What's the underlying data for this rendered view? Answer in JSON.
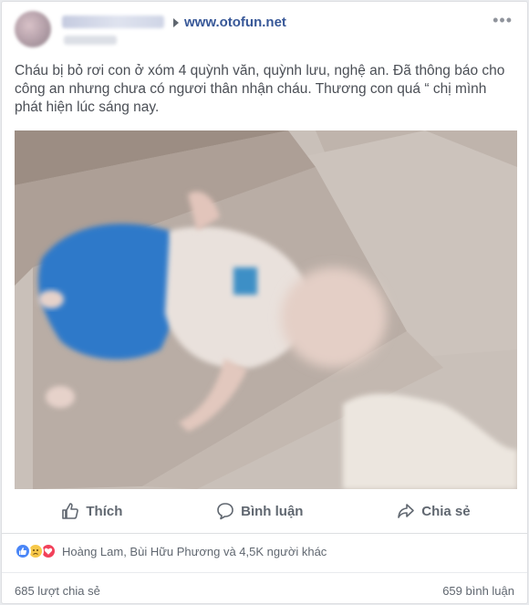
{
  "post": {
    "site": "www.otofun.net",
    "text": "Cháu bị bỏ rơi con ở xóm 4 quỳnh văn, quỳnh lưu, nghệ an. Đã thông báo cho công an nhưng chưa có ngươi thân nhận cháu. Thương con quá “ chị mình phát hiện lúc sáng nay."
  },
  "actions": {
    "like_label": "Thích",
    "comment_label": "Bình luận",
    "share_label": "Chia sẻ"
  },
  "reactions": {
    "types": [
      "like-icon",
      "sad-icon",
      "love-icon"
    ],
    "names": "Hoàng Lam, Bùi Hữu Phương và 4,5K người khác"
  },
  "stats": {
    "shares": "685 lượt chia sẻ",
    "comments": "659 bình luận"
  },
  "colors": {
    "link": "#385898",
    "like": "#4a86f7",
    "sad": "#f7c84a",
    "love": "#f2415a"
  }
}
